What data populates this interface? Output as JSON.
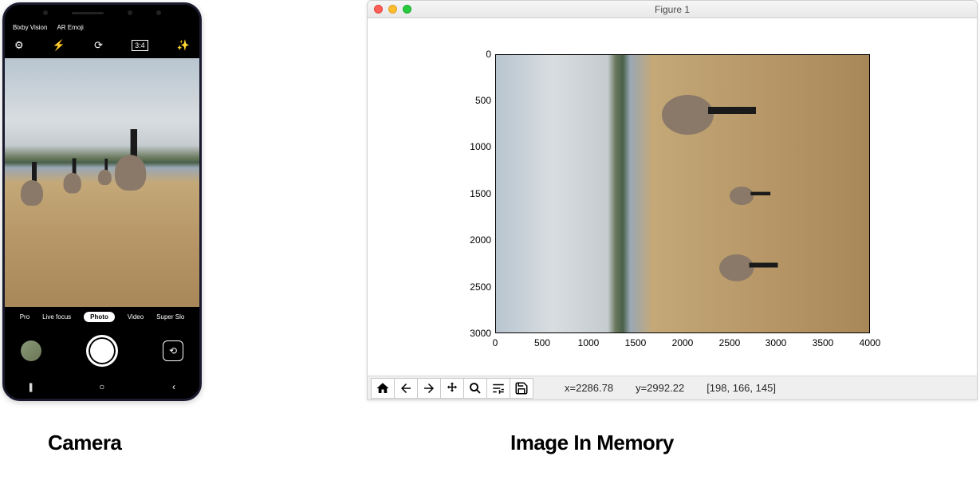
{
  "phone": {
    "top_links": [
      "Bixby Vision",
      "AR Emoji"
    ],
    "icons": {
      "settings": "gear-icon",
      "flash": "flash-icon",
      "timer": "timer-icon",
      "ratio": "ratio-icon",
      "filter": "filter-icon"
    },
    "modes": [
      "Pro",
      "Live focus",
      "Photo",
      "Video",
      "Super Slo"
    ],
    "active_mode": "Photo",
    "nav": [
      "|||",
      "○",
      "‹"
    ]
  },
  "mpl": {
    "title": "Figure 1",
    "yticks": [
      "0",
      "500",
      "1000",
      "1500",
      "2000",
      "2500",
      "3000"
    ],
    "xticks": [
      "0",
      "500",
      "1000",
      "1500",
      "2000",
      "2500",
      "3000",
      "3500",
      "4000"
    ],
    "cursor": {
      "x": "x=2286.78",
      "y": "y=2992.22",
      "rgb": "[198, 166, 145]"
    },
    "toolbar": [
      "home",
      "back",
      "forward",
      "pan",
      "zoom",
      "configure",
      "save"
    ]
  },
  "captions": {
    "left": "Camera",
    "right": "Image In Memory"
  }
}
